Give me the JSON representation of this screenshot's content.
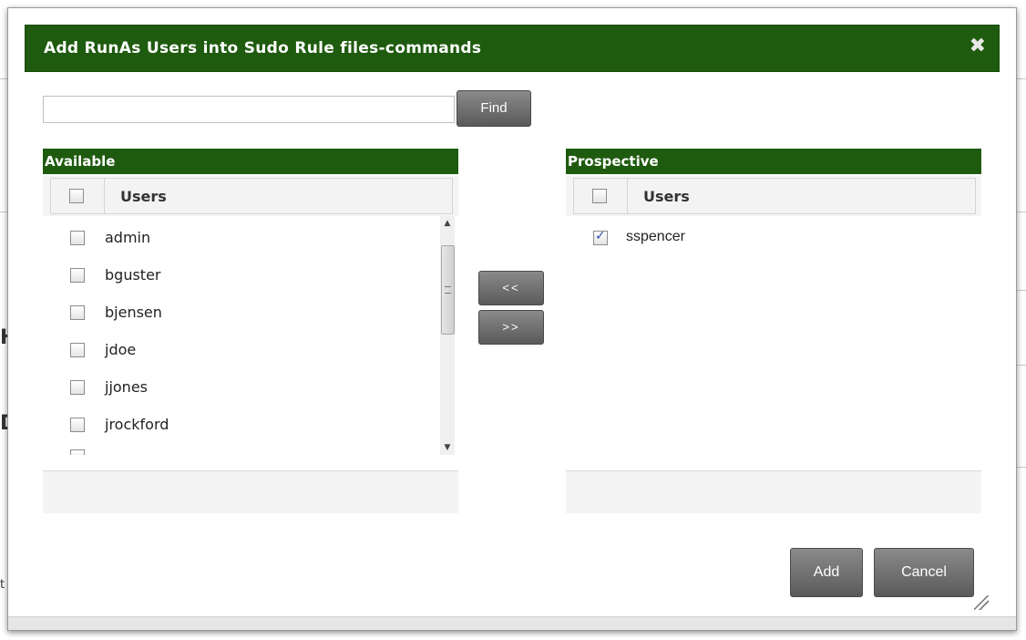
{
  "dialog": {
    "title": "Add RunAs Users into Sudo Rule files-commands",
    "close_glyph": "✖"
  },
  "search": {
    "value": "",
    "placeholder": "",
    "find_label": "Find"
  },
  "available": {
    "header": "Available",
    "column_label": "Users",
    "items": [
      {
        "name": "admin",
        "checked": false
      },
      {
        "name": "bguster",
        "checked": false
      },
      {
        "name": "bjensen",
        "checked": false
      },
      {
        "name": "jdoe",
        "checked": false
      },
      {
        "name": "jjones",
        "checked": false
      },
      {
        "name": "jrockford",
        "checked": false
      }
    ]
  },
  "prospective": {
    "header": "Prospective",
    "column_label": "Users",
    "items": [
      {
        "name": "sspencer",
        "checked": true
      }
    ]
  },
  "move_buttons": {
    "remove_label": "<<",
    "add_label": ">>"
  },
  "footer": {
    "add_label": "Add",
    "cancel_label": "Cancel"
  },
  "background": {
    "glyph_1": "H",
    "glyph_2": "D",
    "glyph_3": "t"
  },
  "colors": {
    "header_green": "#1f5b0f",
    "button_gray": "#6a6a6a"
  },
  "icons": {
    "close": "close-icon",
    "scroll_up": "chevron-up-icon",
    "scroll_down": "chevron-down-icon",
    "resize": "resize-grip-icon"
  }
}
